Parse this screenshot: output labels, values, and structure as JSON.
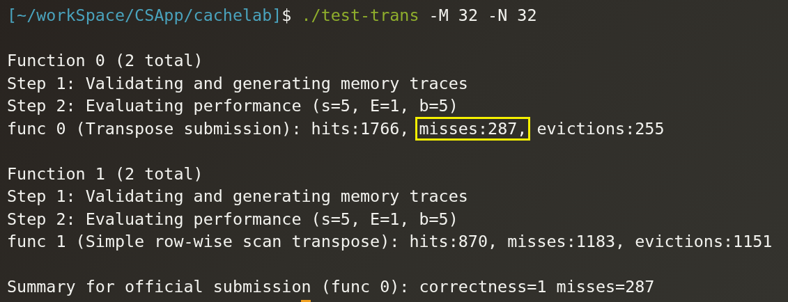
{
  "prompt": {
    "path": "[~/workSpace/CSApp/cachelab]",
    "symbol": "$",
    "command": "./test-trans",
    "args": " -M 32 -N 32"
  },
  "lines": [
    {
      "kind": "blank"
    },
    {
      "kind": "text",
      "segments": [
        {
          "text": "Function 0 (2 total)",
          "highlighted": false
        }
      ]
    },
    {
      "kind": "text",
      "segments": [
        {
          "text": "Step 1: Validating and generating memory traces",
          "highlighted": false
        }
      ]
    },
    {
      "kind": "text",
      "segments": [
        {
          "text": "Step 2: Evaluating performance (s=5, E=1, b=5)",
          "highlighted": false
        }
      ]
    },
    {
      "kind": "text",
      "segments": [
        {
          "text": "func 0 (Transpose submission): hits:1766, ",
          "highlighted": false
        },
        {
          "text": "misses:287,",
          "highlighted": true
        },
        {
          "text": " evictions:255",
          "highlighted": false
        }
      ]
    },
    {
      "kind": "blank"
    },
    {
      "kind": "text",
      "segments": [
        {
          "text": "Function 1 (2 total)",
          "highlighted": false
        }
      ]
    },
    {
      "kind": "text",
      "segments": [
        {
          "text": "Step 1: Validating and generating memory traces",
          "highlighted": false
        }
      ]
    },
    {
      "kind": "text",
      "segments": [
        {
          "text": "Step 2: Evaluating performance (s=5, E=1, b=5)",
          "highlighted": false
        }
      ]
    },
    {
      "kind": "text",
      "segments": [
        {
          "text": "func 1 (Simple row-wise scan transpose): hits:870, misses:1183, evictions:1151",
          "highlighted": false
        }
      ]
    },
    {
      "kind": "blank"
    },
    {
      "kind": "text",
      "segments": [
        {
          "text": "Summary for official submission (func 0): correctness=1 misses=287",
          "highlighted": false
        }
      ]
    }
  ],
  "cursor_visible": true
}
